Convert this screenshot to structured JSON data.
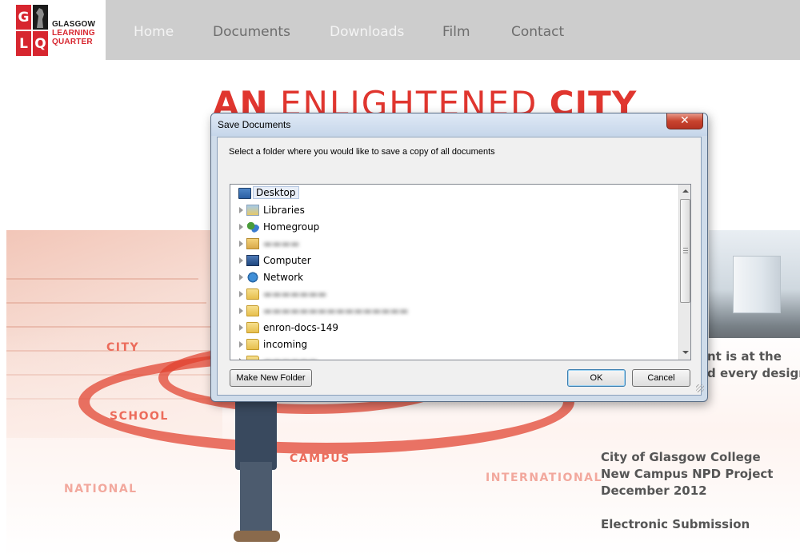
{
  "site": {
    "logo": {
      "letters": [
        "G",
        "L",
        "Q",
        ""
      ],
      "name_lines": [
        "GLASGOW",
        "LEARNING",
        "QUARTER"
      ]
    },
    "nav": [
      "Home",
      "Documents",
      "Downloads",
      "Film",
      "Contact"
    ],
    "hero": {
      "title_bold_1": "AN",
      "title_thin": "ENLIGHTENED",
      "title_bold_2": "CITY"
    },
    "tags": [
      "CITY",
      "SCHOOL",
      "CAMPUS",
      "NATIONAL",
      "INTERNATIONAL"
    ],
    "side_text": [
      "nt is at the",
      "d every design"
    ],
    "info": {
      "line1": "City of Glasgow College",
      "line2": "New Campus NPD Project",
      "line3": "December 2012",
      "line4": "Electronic Submission"
    },
    "colors": {
      "brand_red": "#e0362f",
      "nav_bg": "#cdcdcd",
      "dialog_frame": "#cfdcea"
    }
  },
  "dialog": {
    "title": "Save Documents",
    "close_glyph": "✕",
    "prompt": "Select a folder where you would like to save a copy of all documents",
    "tree": [
      {
        "label": "Desktop",
        "icon": "desktop-icon",
        "expandable": false,
        "selected": true
      },
      {
        "label": "Libraries",
        "icon": "libraries-icon",
        "expandable": true
      },
      {
        "label": "Homegroup",
        "icon": "homegroup-icon",
        "expandable": true
      },
      {
        "label": "",
        "icon": "user-folder-icon",
        "expandable": true,
        "obscured": true
      },
      {
        "label": "Computer",
        "icon": "computer-icon",
        "expandable": true
      },
      {
        "label": "Network",
        "icon": "network-icon",
        "expandable": true
      },
      {
        "label": "",
        "icon": "folder-icon",
        "expandable": true,
        "obscured": true
      },
      {
        "label": "",
        "icon": "folder-icon",
        "expandable": true,
        "obscured": true
      },
      {
        "label": "enron-docs-149",
        "icon": "folder-icon",
        "expandable": true
      },
      {
        "label": "incoming",
        "icon": "folder-icon",
        "expandable": true
      },
      {
        "label": "",
        "icon": "folder-icon",
        "expandable": true,
        "obscured": true
      }
    ],
    "buttons": {
      "new_folder": "Make New Folder",
      "ok": "OK",
      "cancel": "Cancel"
    }
  }
}
